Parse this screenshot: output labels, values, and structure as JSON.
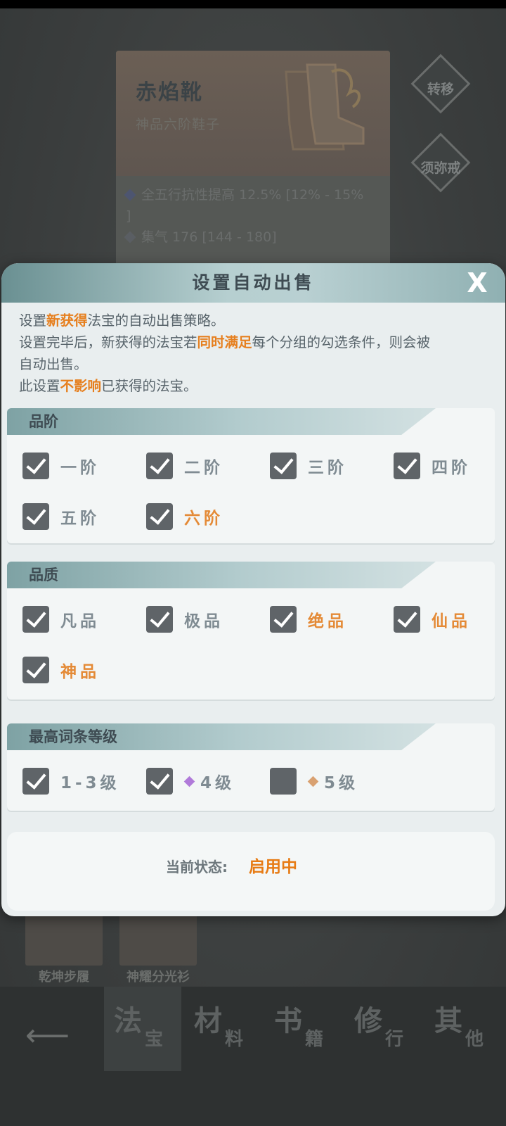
{
  "background": {
    "item_card": {
      "name": "赤焰靴",
      "grade": "神品六阶鞋子",
      "stats": [
        "全五行抗性提高 12.5% [12% - 15%",
        "]",
        "集气 176 [144 - 180]"
      ]
    },
    "side_buttons": [
      {
        "label": "转移",
        "icon": "upload-icon"
      },
      {
        "label": "须弥戒",
        "icon": "ring-icon"
      }
    ],
    "inventory_items": [
      {
        "label": "乾坤步履"
      },
      {
        "label": "神耀分光衫"
      }
    ],
    "bottom_nav": {
      "back_icon": "arrow-left-icon",
      "tabs": [
        {
          "big": "法",
          "small": "宝",
          "active": true
        },
        {
          "big": "材",
          "small": "料",
          "active": false
        },
        {
          "big": "书",
          "small": "籍",
          "active": false
        },
        {
          "big": "修",
          "small": "行",
          "active": false
        },
        {
          "big": "其",
          "small": "他",
          "active": false
        }
      ]
    }
  },
  "modal": {
    "title": "设置自动出售",
    "close_label": "X",
    "description": {
      "l1a": "设置",
      "l1b": "新获得",
      "l1c": "法宝的自动出售策略。",
      "l2a": "设置完毕后，新获得的法宝若",
      "l2b": "同时满足",
      "l2c": "每个分组的勾选条件，则会被",
      "l3": "自动出售。",
      "l4a": "此设置",
      "l4b": "不影响",
      "l4c": "已获得的法宝。"
    },
    "sections": {
      "tier": {
        "title": "品阶",
        "options": [
          {
            "label": "一阶",
            "checked": true
          },
          {
            "label": "二阶",
            "checked": true
          },
          {
            "label": "三阶",
            "checked": true
          },
          {
            "label": "四阶",
            "checked": true
          },
          {
            "label": "五阶",
            "checked": true
          },
          {
            "label": "六阶",
            "checked": true,
            "color": "orange"
          }
        ]
      },
      "quality": {
        "title": "品质",
        "options": [
          {
            "label": "凡品",
            "checked": true
          },
          {
            "label": "极品",
            "checked": true
          },
          {
            "label": "绝品",
            "checked": true,
            "color": "orange"
          },
          {
            "label": "仙品",
            "checked": true,
            "color": "orange"
          },
          {
            "label": "神品",
            "checked": true,
            "color": "orange"
          }
        ]
      },
      "affix_level": {
        "title": "最高词条等级",
        "options": [
          {
            "label": "1-3级",
            "checked": true
          },
          {
            "label": "4级",
            "checked": true,
            "gem_color": "#b07ad9"
          },
          {
            "label": "5级",
            "checked": false,
            "gem_color": "#d9a171"
          }
        ]
      }
    },
    "status": {
      "label": "当前状态:",
      "value": "启用中"
    }
  },
  "colors": {
    "accent_orange": "#e67f1e",
    "checkbox": "#5f6468",
    "modal_bg": "#e9eeef"
  }
}
